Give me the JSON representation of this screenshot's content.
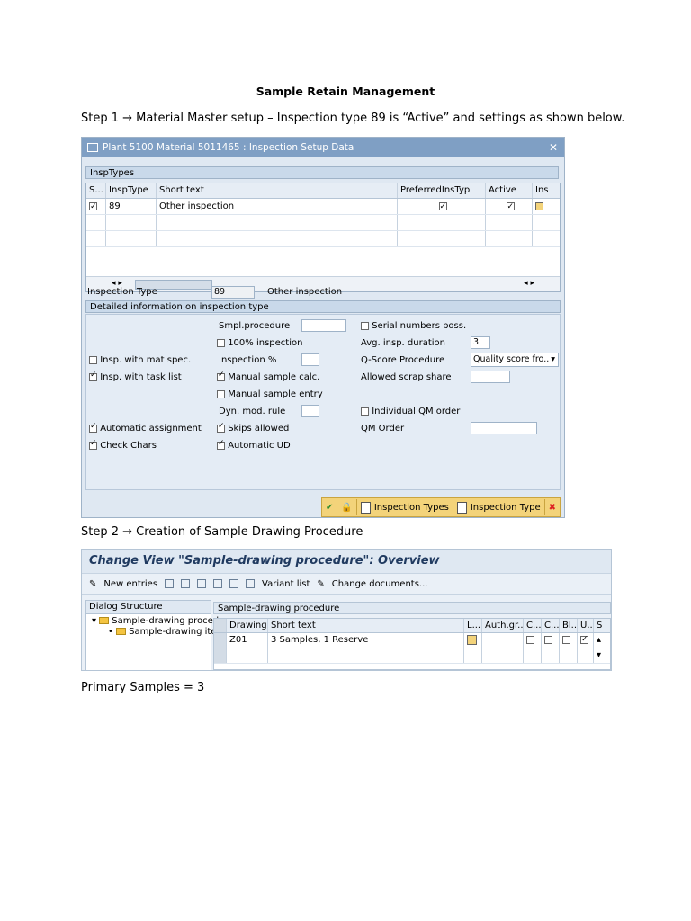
{
  "document": {
    "title": "Sample Retain Management",
    "step1": "Step 1 → Material Master setup – Inspection type 89 is “Active” and settings as shown below.",
    "step2": "Step 2 → Creation of Sample Drawing Procedure",
    "primary": "Primary Samples = 3"
  },
  "window1": {
    "title": "Plant 5100 Material 5011465 : Inspection Setup Data",
    "insp_types_group": "InspTypes",
    "columns": [
      "S...",
      "InspType",
      "Short text",
      "PreferredInsTyp",
      "Active",
      "Ins"
    ],
    "rows": [
      {
        "insp_type": "89",
        "short_text": "Other inspection",
        "selected": true,
        "preferred": true,
        "active": true
      }
    ],
    "inspection_type_label": "Inspection Type",
    "inspection_type_value": "89",
    "inspection_type_text": "Other inspection",
    "detail_group": "Detailed information on inspection type",
    "fields": {
      "smpl_procedure": "Smpl.procedure",
      "serial_numbers": "Serial numbers poss.",
      "pct_100": "100% inspection",
      "avg_duration": "Avg. insp. duration",
      "avg_duration_value": "3",
      "insp_mat_spec": "Insp. with mat spec.",
      "insp_pct": "Inspection %",
      "qscore": "Q-Score Procedure",
      "qscore_value": "Quality score fro..",
      "insp_task_list": "Insp. with task list",
      "manual_sample_calc": "Manual sample calc.",
      "allowed_scrap": "Allowed scrap share",
      "manual_sample_entry": "Manual sample entry",
      "dyn_mod_rule": "Dyn. mod. rule",
      "individual_qm": "Individual QM order",
      "auto_assign": "Automatic assignment",
      "skips_allowed": "Skips allowed",
      "qm_order": "QM Order",
      "check_chars": "Check Chars",
      "automatic_ud": "Automatic UD"
    },
    "buttons": {
      "insp_types": "Inspection Types",
      "insp_type": "Inspection Type"
    }
  },
  "window2": {
    "title": "Change View \"Sample-drawing procedure\": Overview",
    "toolbar": {
      "new_entries": "New entries",
      "variant_list": "Variant list",
      "change_docs": "Change documents..."
    },
    "tree": {
      "header": "Dialog Structure",
      "item1": "Sample-drawing procedu",
      "item2": "Sample-drawing item"
    },
    "group": "Sample-drawing procedure",
    "columns": [
      "Drawing...",
      "Short text",
      "L...",
      "Auth.gr...",
      "C...",
      "C...",
      "Bl...",
      "U...",
      "S"
    ],
    "rows": [
      {
        "drawing": "Z01",
        "short_text": "3 Samples, 1 Reserve"
      }
    ]
  }
}
